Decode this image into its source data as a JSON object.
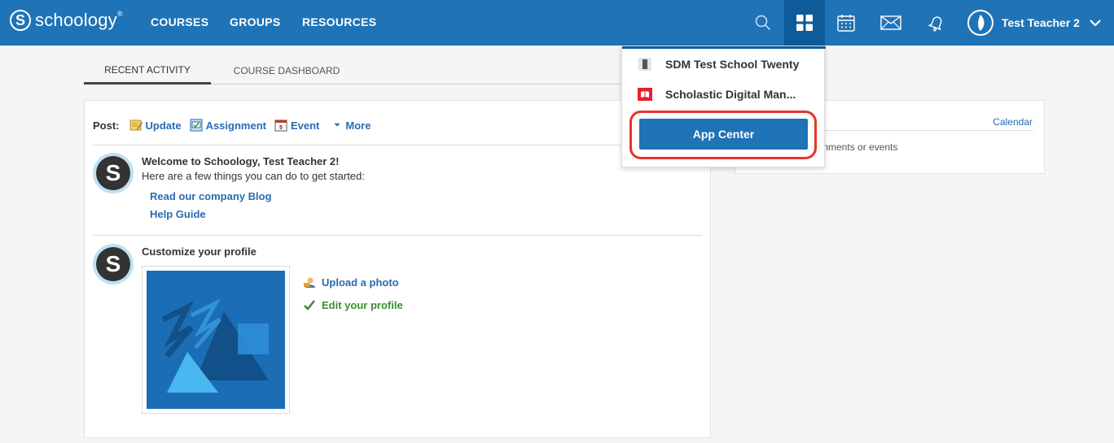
{
  "brand": {
    "logo_text": "schoology",
    "logo_mark": "S",
    "logo_tm": "®"
  },
  "nav": {
    "courses": "COURSES",
    "groups": "GROUPS",
    "resources": "RESOURCES"
  },
  "icons": {
    "search": "search-icon",
    "apps": "grid-icon",
    "calendar": "calendar-icon",
    "mail": "mail-icon",
    "notifications": "bell-icon",
    "user_menu": "chevron-down-icon"
  },
  "user": {
    "name": "Test Teacher 2"
  },
  "tabs": [
    {
      "label": "RECENT ACTIVITY",
      "active": true
    },
    {
      "label": "COURSE DASHBOARD",
      "active": false
    }
  ],
  "post": {
    "label": "Post:",
    "items": [
      {
        "label": "Update",
        "icon": "pencil-note-icon"
      },
      {
        "label": "Assignment",
        "icon": "assignment-icon"
      },
      {
        "label": "Event",
        "icon": "calendar-event-icon"
      },
      {
        "label": "More",
        "icon": "caret-down-icon"
      }
    ]
  },
  "feed": {
    "welcome": {
      "avatar_letter": "S",
      "title": "Welcome to Schoology, Test Teacher 2!",
      "text": "Here are a few things you can do to get started:",
      "links": [
        "Read our company Blog",
        "Help Guide"
      ]
    },
    "profile": {
      "avatar_letter": "S",
      "title": "Customize your profile",
      "actions": [
        {
          "label": "Upload a photo",
          "icon": "upload-photo-icon"
        },
        {
          "label": "Edit your profile",
          "icon": "checkmark-icon"
        }
      ]
    }
  },
  "side": {
    "calendar_link": "Calendar",
    "text": "ignments or events"
  },
  "apps_dropdown": {
    "items": [
      {
        "label": "SDM Test School Twenty",
        "icon": "school-icon"
      },
      {
        "label": "Scholastic Digital Man...",
        "icon": "scholastic-icon"
      }
    ],
    "app_center_label": "App Center"
  },
  "colors": {
    "brand_blue": "#1f73b7",
    "dark_blue": "#0e5b9a",
    "link_blue": "#2a6bb1",
    "success_green": "#3a8f2e",
    "highlight_red": "#e8332a"
  }
}
